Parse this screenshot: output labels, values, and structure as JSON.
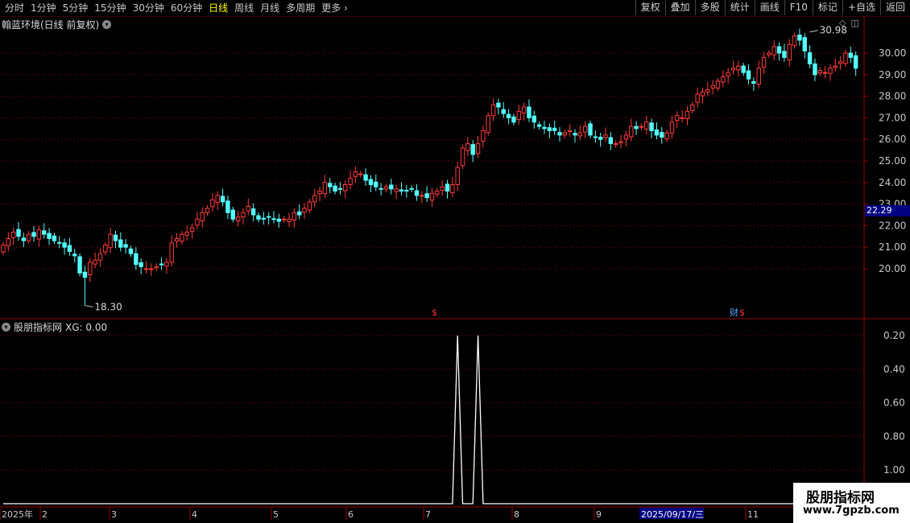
{
  "toolbar": {
    "tabs": [
      "分时",
      "1分钟",
      "5分钟",
      "15分钟",
      "30分钟",
      "60分钟",
      "日线",
      "周线",
      "月线",
      "多周期",
      "更多"
    ],
    "active_tab": "日线",
    "right_buttons": [
      "复权",
      "叠加",
      "多股",
      "统计",
      "画线",
      "F10",
      "标记",
      "+自选",
      "返回"
    ]
  },
  "main_chart": {
    "title": "翰蓝环境(日线 前复权)",
    "high_label": "30.98",
    "low_label": "18.30",
    "current_price": "22.29",
    "markers": [
      {
        "text": "$",
        "date_label": "7"
      },
      {
        "text": "财",
        "date_label": "9"
      },
      {
        "text": "$",
        "date_label": "9"
      }
    ],
    "colors": {
      "up": "#ff3c3c",
      "down": "#54ffff",
      "grid": "#7a0000",
      "axis_text": "#c8c8c8"
    }
  },
  "indicator": {
    "title": "股朋指标网",
    "formula_label": "XG: 0.00",
    "y_ticks": [
      "1.00",
      "0.80",
      "0.60",
      "0.40",
      "0.20"
    ]
  },
  "date_axis": {
    "labels": [
      "2025年",
      "2",
      "3",
      "4",
      "5",
      "6",
      "7",
      "8",
      "9",
      "11"
    ],
    "highlight": "2025/09/17/三"
  },
  "watermark": {
    "line1": "股朋指标网",
    "line2": "www.7gpzb.com"
  },
  "chart_data": [
    {
      "type": "candlestick",
      "title": "翰蓝环境(日线 前复权)",
      "yticks": [
        20,
        21,
        22,
        23,
        24,
        25,
        26,
        27,
        28,
        29,
        30
      ],
      "ylim": [
        18,
        31.3
      ],
      "annotations": [
        {
          "text": "30.98",
          "kind": "max"
        },
        {
          "text": "18.30",
          "kind": "min"
        }
      ],
      "close": [
        21.1,
        21.4,
        21.7,
        21.5,
        21.3,
        21.6,
        21.5,
        21.8,
        21.6,
        21.4,
        21.3,
        21.2,
        21.0,
        20.8,
        20.6,
        19.8,
        19.6,
        20.3,
        20.4,
        20.7,
        21.1,
        21.6,
        21.3,
        21.0,
        21.0,
        20.7,
        20.2,
        20.1,
        20.0,
        20.0,
        20.1,
        20.2,
        20.3,
        21.2,
        21.4,
        21.6,
        21.7,
        21.9,
        22.3,
        22.6,
        22.8,
        23.2,
        23.4,
        23.1,
        22.6,
        22.3,
        22.4,
        22.6,
        22.9,
        22.5,
        22.3,
        22.3,
        22.4,
        22.3,
        22.2,
        22.3,
        22.3,
        22.6,
        22.5,
        22.8,
        23.1,
        23.4,
        23.6,
        24.0,
        23.8,
        23.6,
        23.7,
        23.9,
        24.2,
        24.5,
        24.4,
        24.1,
        23.9,
        23.8,
        23.7,
        23.8,
        23.7,
        23.7,
        23.6,
        23.6,
        23.7,
        23.4,
        23.4,
        23.3,
        23.5,
        23.6,
        23.8,
        23.6,
        23.9,
        24.7,
        25.6,
        25.8,
        25.3,
        25.8,
        26.4,
        27.1,
        27.6,
        27.5,
        27.2,
        27.0,
        26.8,
        27.3,
        27.5,
        27.0,
        26.8,
        26.6,
        26.5,
        26.4,
        26.4,
        26.2,
        26.3,
        26.4,
        26.2,
        26.3,
        26.6,
        26.2,
        26.1,
        26.0,
        26.2,
        25.8,
        25.8,
        25.9,
        26.2,
        26.6,
        26.5,
        26.6,
        26.8,
        26.4,
        26.2,
        26.1,
        26.3,
        26.8,
        27.1,
        27.0,
        27.3,
        27.6,
        28.1,
        28.2,
        28.3,
        28.5,
        28.7,
        28.9,
        29.1,
        29.3,
        29.4,
        29.1,
        28.8,
        28.6,
        29.3,
        29.8,
        30.0,
        30.3,
        30.0,
        29.8,
        30.4,
        30.8,
        30.6,
        30.1,
        29.5,
        29.0,
        29.2,
        29.1,
        29.3,
        29.4,
        29.6,
        30.0,
        29.8,
        29.3
      ]
    },
    {
      "type": "line",
      "name": "XG",
      "ylim": [
        0,
        1.05
      ],
      "yticks": [
        0.2,
        0.4,
        0.6,
        0.8,
        1.0
      ],
      "values": [
        0,
        0,
        0,
        0,
        0,
        0,
        0,
        0,
        0,
        0,
        0,
        0,
        0,
        0,
        0,
        0,
        0,
        0,
        0,
        0,
        0,
        0,
        0,
        0,
        0,
        0,
        0,
        0,
        0,
        0,
        0,
        0,
        0,
        0,
        0,
        0,
        0,
        0,
        0,
        0,
        0,
        0,
        0,
        0,
        0,
        0,
        0,
        0,
        0,
        0,
        0,
        0,
        0,
        0,
        0,
        0,
        0,
        0,
        0,
        0,
        0,
        0,
        0,
        0,
        0,
        0,
        0,
        0,
        0,
        0,
        0,
        0,
        0,
        0,
        0,
        0,
        0,
        0,
        0,
        0,
        0,
        0,
        0,
        0,
        0,
        0,
        0,
        0,
        0,
        1,
        0,
        0,
        0,
        1,
        0,
        0,
        0,
        0,
        0,
        0,
        0,
        0,
        0,
        0,
        0,
        0,
        0,
        0,
        0,
        0,
        0,
        0,
        0,
        0,
        0,
        0,
        0,
        0,
        0,
        0,
        0,
        0,
        0,
        0,
        0,
        0,
        0,
        0,
        0,
        0,
        0,
        0,
        0,
        0,
        0,
        0,
        0,
        0,
        0,
        0,
        0,
        0,
        0,
        0,
        0,
        0,
        0,
        0,
        0,
        0,
        0,
        0,
        0,
        0,
        0,
        0,
        0,
        0,
        0,
        0,
        0,
        0,
        0,
        0,
        0,
        0,
        0,
        0,
        0,
        0,
        0,
        0
      ]
    }
  ]
}
